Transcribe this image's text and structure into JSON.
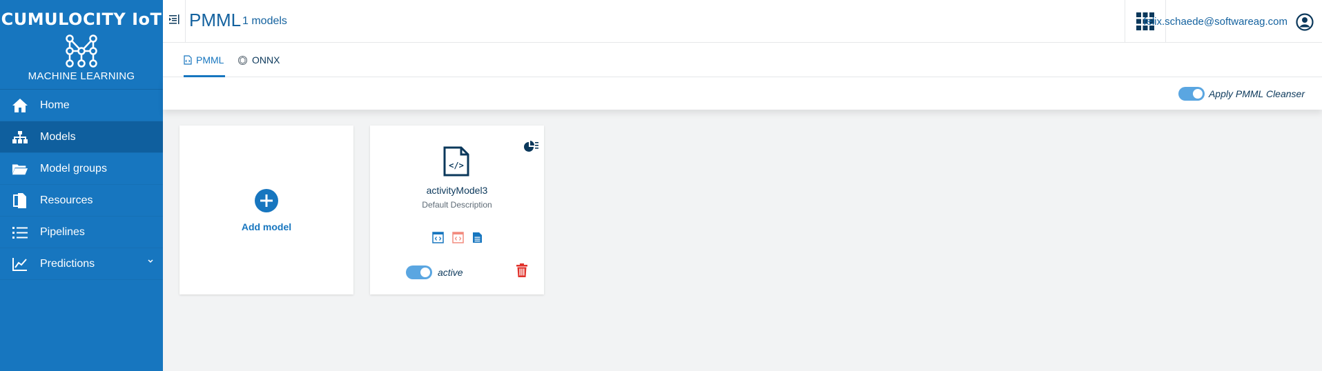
{
  "brand": {
    "title": "CUMULOCITY IoT",
    "subtitle": "MACHINE LEARNING"
  },
  "nav": [
    {
      "label": "Home",
      "icon": "home-icon"
    },
    {
      "label": "Models",
      "icon": "sitemap-icon",
      "active": true
    },
    {
      "label": "Model groups",
      "icon": "folder-icon"
    },
    {
      "label": "Resources",
      "icon": "documents-icon"
    },
    {
      "label": "Pipelines",
      "icon": "list-icon"
    },
    {
      "label": "Predictions",
      "icon": "line-chart-icon",
      "expandable": true
    }
  ],
  "header": {
    "title": "PMML",
    "subtitle": "1 models",
    "user_email": "felix.schaede@softwareag.com"
  },
  "tabs": [
    {
      "label": "PMML",
      "active": true
    },
    {
      "label": "ONNX"
    }
  ],
  "action_bar": {
    "cleanser_label": "Apply PMML Cleanser",
    "cleanser_on": true
  },
  "add_card": {
    "label": "Add model"
  },
  "models": [
    {
      "name": "activityModel3",
      "description": "Default Description",
      "status_label": "active",
      "active": true
    }
  ],
  "colors": {
    "brand_blue": "#1776bf",
    "dark_text": "#0b385b",
    "danger": "#e0322b",
    "switch_on": "#5aa6e1"
  }
}
